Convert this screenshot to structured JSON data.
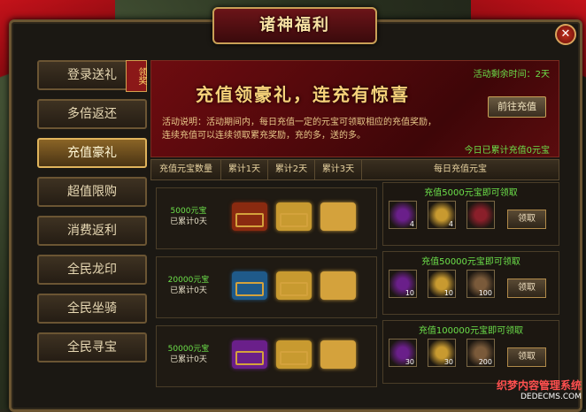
{
  "title": "诸神福利",
  "sidebar": [
    {
      "label": "登录送礼",
      "badge": "领奖"
    },
    {
      "label": "多倍返还"
    },
    {
      "label": "充值豪礼",
      "active": true
    },
    {
      "label": "超值限购"
    },
    {
      "label": "消费返利"
    },
    {
      "label": "全民龙印"
    },
    {
      "label": "全民坐骑"
    },
    {
      "label": "全民寻宝"
    }
  ],
  "banner": {
    "remaining": "活动剩余时间：2天",
    "slogan": "充值领豪礼，连充有惊喜",
    "goto": "前往充值",
    "desc": "活动说明：活动期间内，每日充值一定的元宝可领取相应的充值奖励，连续充值可以连续领取累充奖励，充的多，送的多。",
    "today": "今日已累计充值0元宝"
  },
  "table_headers": [
    "充值元宝数量",
    "累计1天",
    "累计2天",
    "累计3天",
    "每日充值元宝"
  ],
  "tiers": [
    {
      "amount": "5000元宝",
      "cumulative": "已累计0天",
      "chest_colors": [
        "#8a2a10",
        "#c89a30",
        "#d4a23c"
      ],
      "reward_title": "充值5000元宝即可领取",
      "items": [
        {
          "icon": "purple-orb-icon",
          "count": "4",
          "color": "#6a1f8a"
        },
        {
          "icon": "scroll-icon",
          "count": "4",
          "color": "#c89a30"
        },
        {
          "icon": "fire-figure-icon",
          "count": "",
          "color": "#8a1f2a"
        }
      ],
      "claim": "领取"
    },
    {
      "amount": "20000元宝",
      "cumulative": "已累计0天",
      "chest_colors": [
        "#1f5a8a",
        "#c89a30",
        "#d4a23c"
      ],
      "reward_title": "充值50000元宝即可领取",
      "items": [
        {
          "icon": "purple-orb-icon",
          "count": "10",
          "color": "#6a1f8a"
        },
        {
          "icon": "scroll-icon",
          "count": "10",
          "color": "#c89a30"
        },
        {
          "icon": "wood-icon",
          "count": "100",
          "color": "#7a5a3a"
        }
      ],
      "claim": "领取"
    },
    {
      "amount": "50000元宝",
      "cumulative": "已累计0天",
      "chest_colors": [
        "#6a1f8a",
        "#c89a30",
        "#d4a23c"
      ],
      "reward_title": "充值100000元宝即可领取",
      "items": [
        {
          "icon": "purple-orb-icon",
          "count": "30",
          "color": "#6a1f8a"
        },
        {
          "icon": "scroll-icon",
          "count": "30",
          "color": "#c89a30"
        },
        {
          "icon": "wood-icon",
          "count": "200",
          "color": "#7a5a3a"
        }
      ],
      "claim": "领取"
    }
  ],
  "watermark": {
    "line1": "织梦内容管理系统",
    "line2": "DEDECMS.COM"
  }
}
